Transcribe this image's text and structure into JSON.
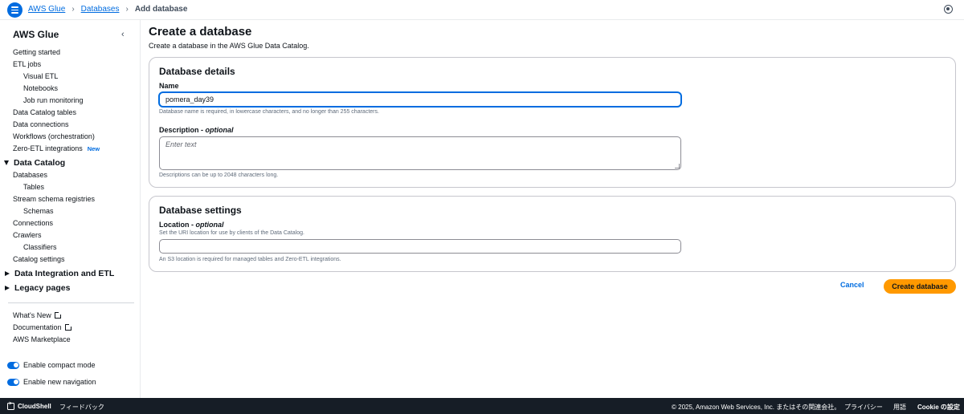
{
  "breadcrumb": {
    "items": [
      "AWS Glue",
      "Databases"
    ],
    "current": "Add database"
  },
  "sidebar": {
    "title": "AWS Glue",
    "top_items": [
      {
        "label": "Getting started"
      },
      {
        "label": "ETL jobs"
      },
      {
        "label": "Visual ETL"
      },
      {
        "label": "Notebooks"
      },
      {
        "label": "Job run monitoring"
      },
      {
        "label": "Data Catalog tables"
      },
      {
        "label": "Data connections"
      },
      {
        "label": "Workflows (orchestration)"
      },
      {
        "label": "Zero-ETL integrations",
        "badge": "New"
      }
    ],
    "data_catalog": {
      "label": "Data Catalog",
      "items": [
        "Databases",
        "Tables",
        "Stream schema registries",
        "Schemas",
        "Connections",
        "Crawlers",
        "Classifiers",
        "Catalog settings"
      ]
    },
    "data_integration": {
      "label": "Data Integration and ETL"
    },
    "legacy": {
      "label": "Legacy pages"
    },
    "links": [
      "What's New",
      "Documentation",
      "AWS Marketplace"
    ],
    "toggles": [
      "Enable compact mode",
      "Enable new navigation"
    ]
  },
  "page": {
    "title": "Create a database",
    "description": "Create a database in the AWS Glue Data Catalog."
  },
  "details_panel": {
    "title": "Database details",
    "name_label": "Name",
    "name_value": "pomera_day39",
    "name_hint": "Database name is required, in lowercase characters, and no longer than 255 characters.",
    "description_label": "Description - ",
    "description_optional": "optional",
    "description_placeholder": "Enter text",
    "description_hint": "Descriptions can be up to 2048 characters long."
  },
  "settings_panel": {
    "title": "Database settings",
    "location_label": "Location - ",
    "location_optional": "optional",
    "location_desc": "Set the URI location for use by clients of the Data Catalog.",
    "location_value": "",
    "location_hint": "An S3 location is required for managed tables and Zero-ETL integrations."
  },
  "actions": {
    "cancel": "Cancel",
    "create": "Create database"
  },
  "footer": {
    "cloudshell": "CloudShell",
    "feedback": "フィードバック",
    "copyright": "© 2025, Amazon Web Services, Inc. またはその関連会社。",
    "privacy": "プライバシー",
    "terms": "用語",
    "cookie": "Cookie の設定"
  },
  "colors": {
    "accent": "#006ce0",
    "primary_button": "#ff9900",
    "footer_bg": "#161d26"
  }
}
